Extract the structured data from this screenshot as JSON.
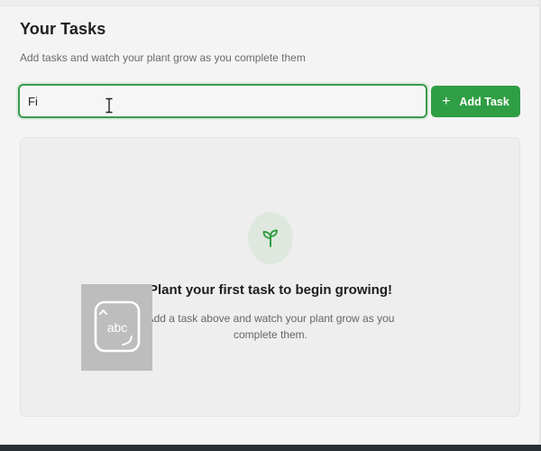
{
  "header": {
    "title": "Your Tasks",
    "subtitle": "Add tasks and watch your plant grow as you complete them"
  },
  "task_input": {
    "value": "Fi",
    "placeholder": ""
  },
  "add_button": {
    "label": "Add Task",
    "icon": "plus-icon"
  },
  "empty_state": {
    "icon": "sprout-icon",
    "title": "Plant your first task to begin growing!",
    "description": "Add a task above and watch your plant grow as you complete them."
  },
  "keyboard_overlay": {
    "icon": "keyboard-input-icon",
    "label": "abc"
  },
  "colors": {
    "accent": "#2f9e44",
    "sprout": "#2f9e44",
    "page_background": "#f4f4f4",
    "panel_background": "#eeeeee"
  }
}
